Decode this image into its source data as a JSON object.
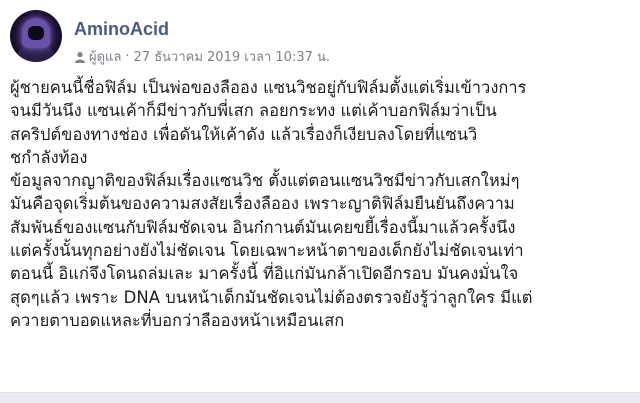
{
  "post": {
    "author": "AminoAcid",
    "role": "ผู้ดูแล",
    "separator": "·",
    "timestamp": "27 ธันวาคม 2019 เวลา 10:37 น.",
    "lines": [
      "ผู้ชายคนนี้ชื่อฟิล์ม เป็นพ่อของลืออง แซนวิชอยู่กับฟิล์มตั้งแต่เริ่มเข้าวงการ",
      "จนมีวันนึง แซนเค้าก็มีข่าวกับพี่เสก ลอยกระทง แต่เค้าบอกฟิล์มว่าเป็น",
      "สคริปต์ของทางช่อง เพื่อดันให้เค้าดัง แล้วเรื่องก็เงียบลงโดยที่แซนวิ",
      "ชกำลังท้อง",
      "ข้อมูลจากญาติของฟิล์มเรื่องแซนวิช ตั้งแต่ตอนแซนวิชมีข่าวกับเสกใหม่ๆ",
      "มันคือจุดเริ่มต้นของความสงสัยเรื่องลืออง เพราะญาติฟิล์มยืนยันถึงความ",
      "สัมพันธ์ของแซนกับฟิล์มชัดเจน อินก๋กานต์มันเคยขยี้เรื่องนี้มาแล้วครั้งนึง",
      "แต่ครั้งนั้นทุกอย่างยังไม่ชัดเจน โดยเฉพาะหน้าตาของเด็กยังไม่ชัดเจนเท่า",
      "ตอนนี้ อิแก่จึงโดนถล่มเละ มาครั้งนี้ ที่อิแก่มันกล้าเปิดอีกรอบ มันคงมั่นใจ",
      "สุดๆแล้ว เพราะ DNA บนหน้าเด็กมันชัดเจนไม่ต้องตรวจยังรู้ว่าลูกใคร มีแต่",
      "ควายตาบอดแหละที่บอกว่าลือองหน้าเหมือนเสก"
    ]
  },
  "icons": {
    "avatar": "hooded-figure-avatar",
    "role": "person-icon"
  },
  "colors": {
    "author_name": "#4a5a82",
    "meta_text": "#7d8289",
    "body_text": "#1c1e21"
  }
}
